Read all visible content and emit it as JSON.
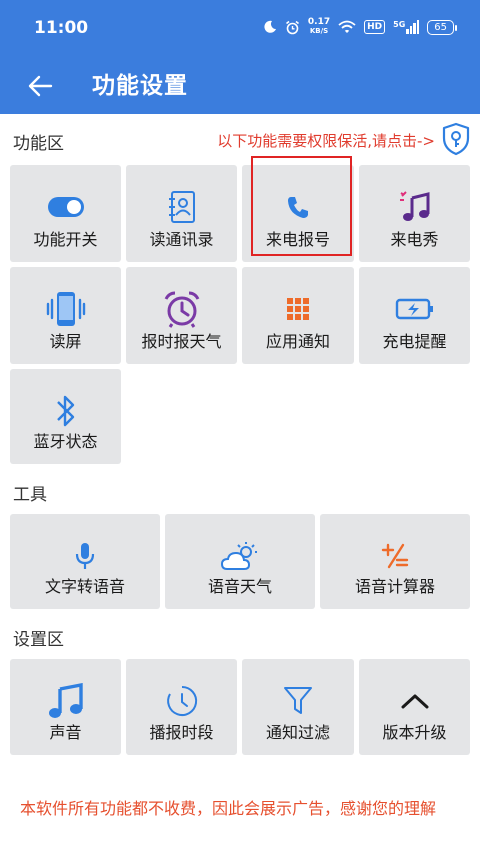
{
  "colors": {
    "header": "#3b7ddd",
    "accent": "#2f7fe0",
    "warning_text": "#e03c2e",
    "tile_bg": "#e4e5e7"
  },
  "status_bar": {
    "time": "11:00",
    "net_speed_value": "0.17",
    "net_speed_unit": "KB/S",
    "hd": "HD",
    "network": "5G",
    "battery": "65"
  },
  "nav": {
    "back_icon": "arrow-left-icon",
    "title": "功能设置"
  },
  "function_area": {
    "title": "功能区",
    "permission_note": "以下功能需要权限保活,请点击->",
    "permission_icon": "shield-key-icon",
    "tiles": [
      {
        "label": "功能开关",
        "icon": "toggle-icon"
      },
      {
        "label": "读通讯录",
        "icon": "contacts-book-icon"
      },
      {
        "label": "来电报号",
        "icon": "phone-icon"
      },
      {
        "label": "来电秀",
        "icon": "music-note-icon"
      },
      {
        "label": "读屏",
        "icon": "phone-vibrate-icon"
      },
      {
        "label": "报时报天气",
        "icon": "alarm-clock-icon"
      },
      {
        "label": "应用通知",
        "icon": "apps-grid-icon"
      },
      {
        "label": "充电提醒",
        "icon": "battery-charging-icon"
      },
      {
        "label": "蓝牙状态",
        "icon": "bluetooth-icon"
      }
    ]
  },
  "tools": {
    "title": "工具",
    "tiles": [
      {
        "label": "文字转语音",
        "icon": "microphone-icon"
      },
      {
        "label": "语音天气",
        "icon": "weather-icon"
      },
      {
        "label": "语音计算器",
        "icon": "calculator-icon"
      }
    ]
  },
  "settings_area": {
    "title": "设置区",
    "tiles": [
      {
        "label": "声音",
        "icon": "music-notes-icon"
      },
      {
        "label": "播报时段",
        "icon": "clock-icon"
      },
      {
        "label": "通知过滤",
        "icon": "filter-icon"
      },
      {
        "label": "版本升级",
        "icon": "chevron-up-icon"
      }
    ]
  },
  "footer_note": "本软件所有功能都不收费，因此会展示广告，感谢您的理解"
}
